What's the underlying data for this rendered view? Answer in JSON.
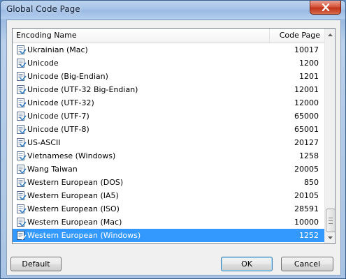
{
  "window": {
    "title": "Global Code Page"
  },
  "list": {
    "columns": [
      "Encoding Name",
      "Code Page"
    ],
    "rows": [
      {
        "name": "Ukrainian (Mac)",
        "code": "10017"
      },
      {
        "name": "Unicode",
        "code": "1200"
      },
      {
        "name": "Unicode (Big-Endian)",
        "code": "1201"
      },
      {
        "name": "Unicode (UTF-32 Big-Endian)",
        "code": "12001"
      },
      {
        "name": "Unicode (UTF-32)",
        "code": "12000"
      },
      {
        "name": "Unicode (UTF-7)",
        "code": "65000"
      },
      {
        "name": "Unicode (UTF-8)",
        "code": "65001"
      },
      {
        "name": "US-ASCII",
        "code": "20127"
      },
      {
        "name": "Vietnamese (Windows)",
        "code": "1258"
      },
      {
        "name": "Wang Taiwan",
        "code": "20005"
      },
      {
        "name": "Western European (DOS)",
        "code": "850"
      },
      {
        "name": "Western European (IA5)",
        "code": "20105"
      },
      {
        "name": "Western European (ISO)",
        "code": "28591"
      },
      {
        "name": "Western European (Mac)",
        "code": "10000"
      },
      {
        "name": "Western European (Windows)",
        "code": "1252"
      }
    ],
    "selected_index": 14
  },
  "buttons": {
    "default": "Default",
    "ok": "OK",
    "cancel": "Cancel"
  },
  "colors": {
    "selection": "#3399ff",
    "close": "#c7422a"
  },
  "icons": {
    "row": "encoding-file-icon",
    "close": "close-icon"
  }
}
